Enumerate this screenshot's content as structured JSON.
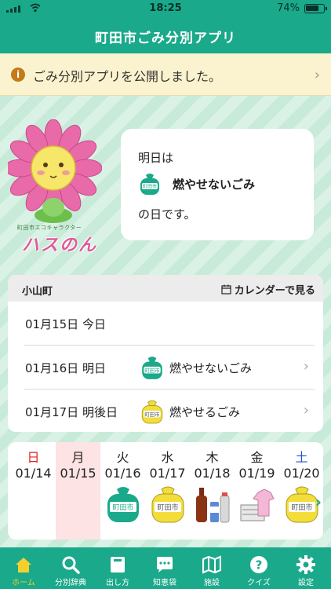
{
  "status": {
    "time": "18:25",
    "battery": "74%"
  },
  "nav": {
    "title": "町田市ごみ分別アプリ"
  },
  "notice": {
    "text": "ごみ分別アプリを公開しました。"
  },
  "mascot": {
    "caption": "町田市エコキャラクター",
    "name": "ハスのん"
  },
  "tomorrow": {
    "line1": "明日は",
    "bag_label": "町田市",
    "type": "燃やせないごみ",
    "line3": "の日です。"
  },
  "schedule": {
    "area": "小山町",
    "calendar_link": "カレンダーで見る",
    "rows": [
      {
        "date": "01月15日 今日",
        "type": ""
      },
      {
        "date": "01月16日 明日",
        "type": "燃やせないごみ",
        "bag": "green"
      },
      {
        "date": "01月17日 明後日",
        "type": "燃やせるごみ",
        "bag": "yellow"
      }
    ]
  },
  "week": {
    "days": [
      {
        "name": "日",
        "date": "01/14",
        "color": "#e02020"
      },
      {
        "name": "月",
        "date": "01/15",
        "color": "#222222"
      },
      {
        "name": "火",
        "date": "01/16",
        "color": "#222222",
        "icon": "green-bag"
      },
      {
        "name": "水",
        "date": "01/17",
        "color": "#222222",
        "icon": "yellow-bag"
      },
      {
        "name": "木",
        "date": "01/18",
        "color": "#222222",
        "icon": "bottles-cans"
      },
      {
        "name": "金",
        "date": "01/19",
        "color": "#222222",
        "icon": "paper-cloth"
      },
      {
        "name": "土",
        "date": "01/20",
        "color": "#1f4fd8",
        "icon": "yellow-bag"
      }
    ],
    "bag_text": "町田市"
  },
  "tabs": [
    {
      "label": "ホーム",
      "icon": "home-icon",
      "active": true
    },
    {
      "label": "分別辞典",
      "icon": "search-icon"
    },
    {
      "label": "出し方",
      "icon": "book-icon"
    },
    {
      "label": "知恵袋",
      "icon": "chat-icon"
    },
    {
      "label": "施設",
      "icon": "map-icon"
    },
    {
      "label": "クイズ",
      "icon": "question-icon"
    },
    {
      "label": "設定",
      "icon": "gear-icon"
    }
  ],
  "colors": {
    "brand": "#1aa98a",
    "notice_bg": "#fbf3cf",
    "active_tab": "#f3d02e",
    "today_bg": "#fde3e3"
  }
}
